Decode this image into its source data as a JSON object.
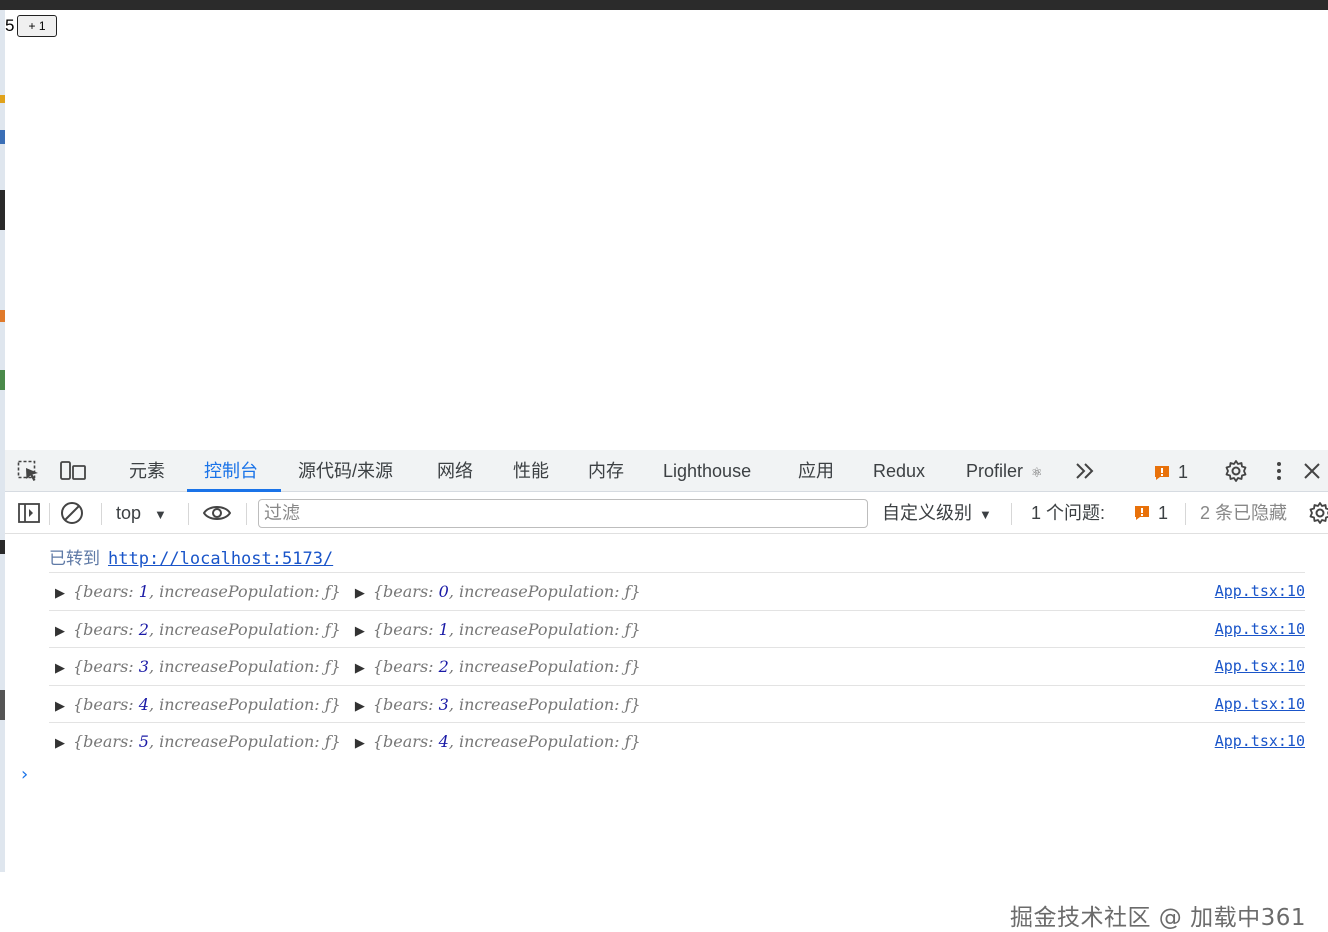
{
  "page": {
    "count": "5",
    "increment_label": "+ 1"
  },
  "devtools": {
    "tabs": [
      "元素",
      "控制台",
      "源代码/来源",
      "网络",
      "性能",
      "内存",
      "Lighthouse",
      "应用",
      "Redux",
      "Profiler"
    ],
    "active_tab": "控制台",
    "more_tabs_icon": "chevron-double-right-icon",
    "issues_badge_count": "1",
    "icons": [
      "inspect-element-icon",
      "device-toolbar-icon",
      "sidebar-toggle-icon",
      "clear-console-icon",
      "eye-icon",
      "settings-icon",
      "more-vert-icon",
      "close-icon",
      "react-icon"
    ]
  },
  "toolbar": {
    "context": "top",
    "filter_placeholder": "过滤",
    "levels": "自定义级别",
    "issues_label": "1 个问题:",
    "issues_count": "1",
    "hidden_label": "2 条已隐藏"
  },
  "console": {
    "navigated_label": "已转到",
    "navigated_url": "http://localhost:5173/",
    "rows": [
      {
        "a": "1",
        "b": "0",
        "source": "App.tsx:10"
      },
      {
        "a": "2",
        "b": "1",
        "source": "App.tsx:10"
      },
      {
        "a": "3",
        "b": "2",
        "source": "App.tsx:10"
      },
      {
        "a": "4",
        "b": "3",
        "source": "App.tsx:10"
      },
      {
        "a": "5",
        "b": "4",
        "source": "App.tsx:10"
      }
    ],
    "obj_prefix": "{bears: ",
    "obj_suffix": ", increasePopulation: ƒ}",
    "prompt_symbol": "›"
  },
  "watermark": "掘金技术社区 @ 加载中361",
  "colors": {
    "accent": "#1a73e8",
    "issue_orange": "#e8710a",
    "link": "#1a55c9"
  }
}
